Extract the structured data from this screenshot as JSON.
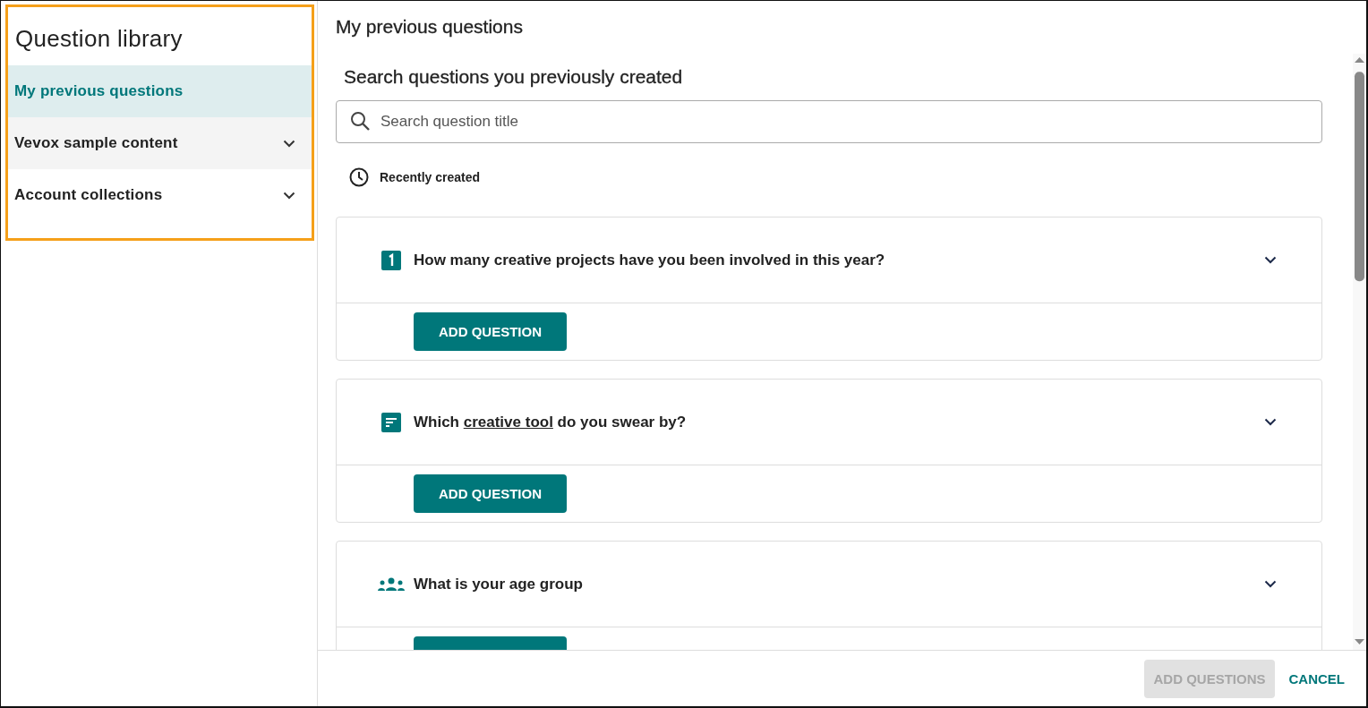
{
  "sidebar": {
    "title": "Question library",
    "items": [
      {
        "label": "My previous questions",
        "selected": true,
        "expandable": false
      },
      {
        "label": "Vevox sample content",
        "selected": false,
        "expandable": true
      },
      {
        "label": "Account collections",
        "selected": false,
        "expandable": true
      }
    ]
  },
  "main": {
    "title": "My previous questions",
    "heading": "Search questions you previously created",
    "search": {
      "placeholder": "Search question title"
    },
    "sort": {
      "label": "Recently created"
    },
    "questions": [
      {
        "kind": "number",
        "text": "How many creative projects have you been involved in this year?",
        "button": "ADD QUESTION"
      },
      {
        "kind": "text",
        "text": "Which **creative tool** do you swear by?",
        "button": "ADD QUESTION"
      },
      {
        "kind": "group",
        "text": "What is your age group"
      }
    ]
  },
  "footer": {
    "buttons": [
      {
        "label": "ADD QUESTIONS",
        "kind": "primary",
        "disabled": true
      },
      {
        "label": "CANCEL",
        "kind": "text",
        "disabled": false
      }
    ]
  }
}
